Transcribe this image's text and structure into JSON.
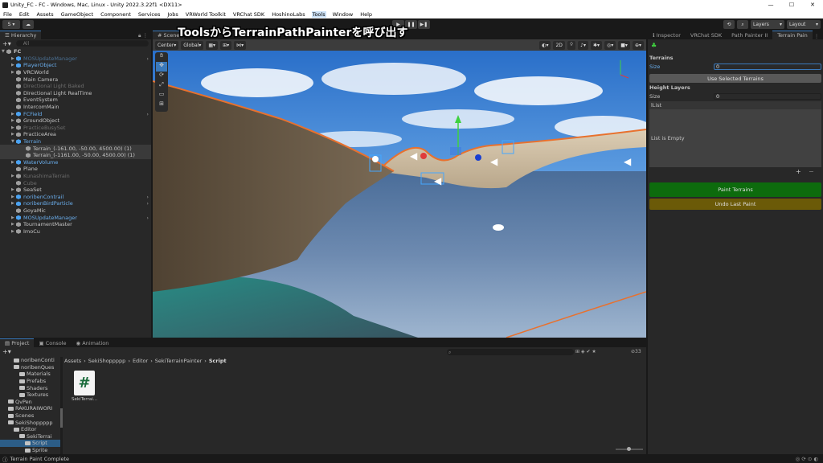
{
  "window": {
    "title": "Unity_FC - FC - Windows, Mac, Linux - Unity 2022.3.22f1 <DX11>",
    "minimize": "—",
    "maximize": "☐",
    "close": "✕"
  },
  "menu": [
    "File",
    "Edit",
    "Assets",
    "GameObject",
    "Component",
    "Services",
    "Jobs",
    "VRWorld Toolkit",
    "VRChat SDK",
    "HoshinoLabs",
    "Tools",
    "Window",
    "Help"
  ],
  "toolbar": {
    "account": "S",
    "play_icons": [
      "▶",
      "❚❚",
      "▶❚"
    ],
    "layers": "Layers",
    "layout": "Layout"
  },
  "annotation": "ToolsからTerrainPathPainterを呼び出す",
  "hierarchy": {
    "tab": "Hierarchy",
    "search_placeholder": "All",
    "items": [
      {
        "label": "FC",
        "depth": 0
      },
      {
        "label": "MOSUpdateManager",
        "depth": 1
      },
      {
        "label": "PlayerObject",
        "depth": 1
      },
      {
        "label": "VRCWorld",
        "depth": 1
      },
      {
        "label": "Main Camera",
        "depth": 1
      },
      {
        "label": "Directional Light Baked",
        "depth": 1
      },
      {
        "label": "Directional Light RealTime",
        "depth": 1
      },
      {
        "label": "EventSystem",
        "depth": 1
      },
      {
        "label": "IntercomMain",
        "depth": 1
      },
      {
        "label": "FCField",
        "depth": 1
      },
      {
        "label": "GroundObject",
        "depth": 1
      },
      {
        "label": "PracticeBusySet",
        "depth": 1
      },
      {
        "label": "PracticeArea",
        "depth": 1
      },
      {
        "label": "Terrain",
        "depth": 1
      },
      {
        "label": "Terrain_(-161.00, -50.00, 4500.00) (1)",
        "depth": 2
      },
      {
        "label": "Terrain_(-1161.00, -50.00, 4500.00) (1)",
        "depth": 2
      },
      {
        "label": "WaterVolume",
        "depth": 1
      },
      {
        "label": "Plane",
        "depth": 1
      },
      {
        "label": "KunashimaTerrain",
        "depth": 1
      },
      {
        "label": "Cube",
        "depth": 1
      },
      {
        "label": "SeaSet",
        "depth": 1
      },
      {
        "label": "noribenContrail",
        "depth": 1
      },
      {
        "label": "noribenBirdParticle",
        "depth": 1
      },
      {
        "label": "GoyaMic",
        "depth": 1
      },
      {
        "label": "MOSUpdateManager",
        "depth": 1
      },
      {
        "label": "TournamentMaster",
        "depth": 1
      },
      {
        "label": "ImoCu",
        "depth": 1
      }
    ]
  },
  "scene": {
    "tab": "Scene",
    "pivot": "Center",
    "space": "Global"
  },
  "inspector": {
    "tabs": [
      "Inspector",
      "VRChat SDK",
      "Path Painter II",
      "Terrain Pain"
    ],
    "terrains_header": "Terrains",
    "size_label": "Size",
    "size_value": "0",
    "use_selected": "Use Selected Terrains",
    "height_header": "Height Layers",
    "height_size_label": "Size",
    "height_size_value": "0",
    "list_header": "lList",
    "list_empty": "List is Empty",
    "paint_button": "Paint Terrains",
    "undo_button": "Undo Last Paint",
    "paint_color": "#0d6b0d",
    "undo_color": "#6b5a08"
  },
  "project": {
    "tabs": [
      "Project",
      "Console",
      "Animation"
    ],
    "breadcrumb": [
      "Assets",
      "SekiShoppppp",
      "Editor",
      "SekiTerrainPainter",
      "Script"
    ],
    "hidden_count": "33",
    "tree": [
      {
        "label": "noribenConti",
        "depth": 1
      },
      {
        "label": "noribenQues",
        "depth": 1
      },
      {
        "label": "Materials",
        "depth": 2
      },
      {
        "label": "Prefabs",
        "depth": 2
      },
      {
        "label": "Shaders",
        "depth": 2
      },
      {
        "label": "Textures",
        "depth": 2
      },
      {
        "label": "QvPen",
        "depth": 0
      },
      {
        "label": "RAKURAIWORI",
        "depth": 0
      },
      {
        "label": "Scenes",
        "depth": 0
      },
      {
        "label": "SekiShoppppp",
        "depth": 0
      },
      {
        "label": "Editor",
        "depth": 1
      },
      {
        "label": "SekiTerrai",
        "depth": 2
      },
      {
        "label": "Script",
        "depth": 3
      },
      {
        "label": "Sprite",
        "depth": 3
      }
    ],
    "file": {
      "name": "SekiTerrai…",
      "icon": "#"
    }
  },
  "status": "Terrain Paint Complete"
}
